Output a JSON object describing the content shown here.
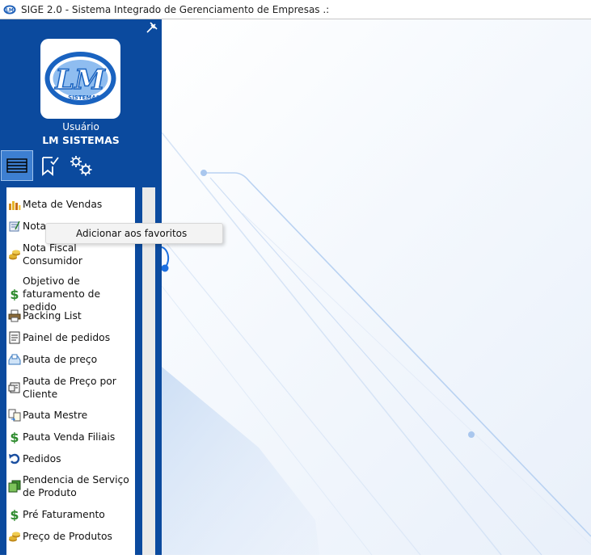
{
  "window": {
    "title": "SIGE 2.0 - Sistema Integrado de Gerenciamento de Empresas .:"
  },
  "sidebar": {
    "logo_text": "LM",
    "logo_subtext": "SISTEMAS",
    "user_label": "Usuário",
    "user_name": "LM SISTEMAS",
    "tabs": [
      {
        "icon": "menu-list-icon",
        "active": true
      },
      {
        "icon": "favorites-icon",
        "active": false
      },
      {
        "icon": "settings-icon",
        "active": false
      }
    ],
    "items": [
      {
        "label": "Meta de Vendas",
        "icon": "bar-chart-icon"
      },
      {
        "label": "Nota",
        "icon": "invoice-icon"
      },
      {
        "label": "Nota Fiscal Consumidor",
        "icon": "coins-icon"
      },
      {
        "label": "Objetivo de faturamento de pedido",
        "icon": "dollar-icon"
      },
      {
        "label": "Packing List",
        "icon": "printer-icon"
      },
      {
        "label": "Painel de pedidos",
        "icon": "document-icon"
      },
      {
        "label": "Pauta de preço",
        "icon": "price-tray-icon"
      },
      {
        "label": "Pauta de Preço por Cliente",
        "icon": "client-price-icon"
      },
      {
        "label": "Pauta Mestre",
        "icon": "copy-arrow-icon"
      },
      {
        "label": "Pauta Venda Filiais",
        "icon": "dollar-icon"
      },
      {
        "label": "Pedidos",
        "icon": "undo-icon"
      },
      {
        "label": "Pendencia de Serviço de Produto",
        "icon": "pages-icon"
      },
      {
        "label": "Pré Faturamento",
        "icon": "dollar-icon"
      },
      {
        "label": "Preço de Produtos",
        "icon": "coins-icon"
      }
    ]
  },
  "context_menu": {
    "item": "Adicionar aos favoritos"
  },
  "colors": {
    "sidebar": "#0b4a9e",
    "tab_active": "#3d7fd1",
    "accent_dot": "#1c6fe0"
  }
}
